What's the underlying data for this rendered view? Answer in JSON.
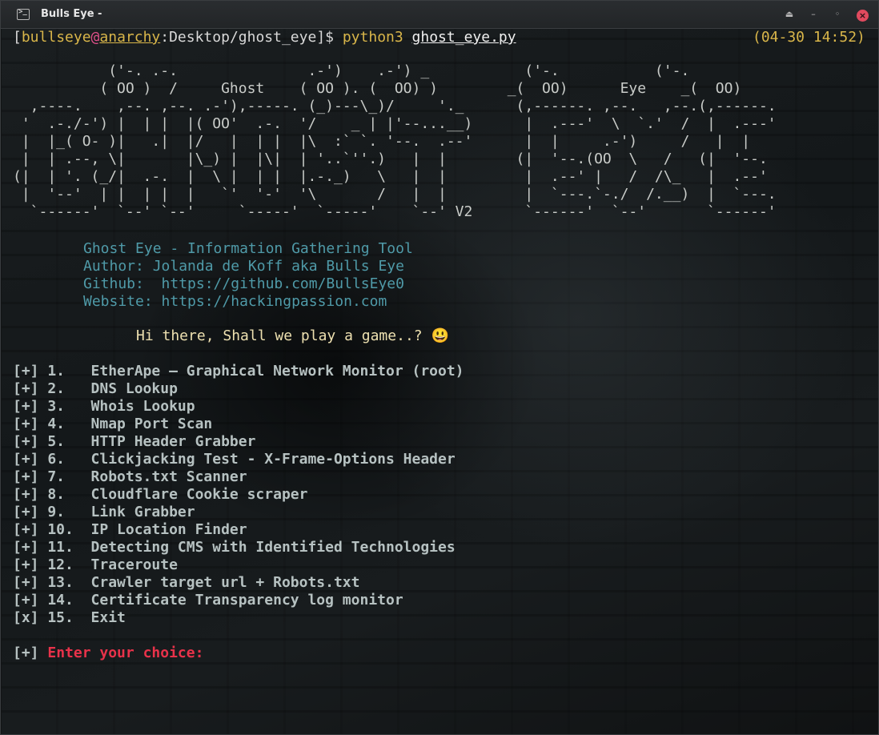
{
  "window": {
    "title": "Bulls Eye -",
    "buttons": {
      "eject": "⏏",
      "minimize": "–",
      "maximize": "◦",
      "close": "×"
    }
  },
  "prompt": {
    "open": "[",
    "user": "bullseye",
    "at": "@",
    "host": "anarchy",
    "path": ":Desktop/ghost_eye]",
    "dollar": "$ ",
    "command": "python3",
    "space": " ",
    "file": "ghost_eye.py",
    "datetime": "(04-30 14:52)"
  },
  "banner": {
    "ascii": "           ('-. .-.               .-')    .-') _           ('-.           ('-.\n          ( OO )  /     Ghost    ( OO ). (  OO) )        _(  OO)      Eye    _(  OO)\n  ,----.    ,--. ,--. .-'),-----. (_)---\\_)/     '._      (,------. ,--.   ,--.(,------.\n '  .-./-') |  | |  |( OO'  .-.  '/    _ | |'--...__)      |  .---'  \\  `.'  /  |  .---'\n |  |_( O- )|   .|  |/   |  | |  |\\  :` `. '--.  .--'      |  |     .-')     /   |  |\n |  | .--, \\|       |\\_) |  |\\|  | '..`''.)   |  |        (|  '--.(OO  \\   /   (|  '--.\n(|  | '. (_/|  .-.  |  \\ |  | |  |.-._)   \\   |  |         |  .--' |   /  /\\_   |  .--'\n |  '--'  | |  | |  |   `'  '-'  '\\       /   |  |         |  `---.`-./  /.__)  |  `---.\n  `------'  `--' `--'     `-----'  `-----'    `--' V2      `------'  `--'       `------'"
  },
  "info": {
    "line1": "Ghost Eye - Information Gathering Tool",
    "line2": "Author: Jolanda de Koff aka Bulls Eye",
    "line3": "Github:  https://github.com/BullsEye0",
    "line4": "Website: https://hackingpassion.com"
  },
  "greeting": "Hi there, Shall we play a game..? 😃",
  "menu": [
    "[+] 1.   EtherApe – Graphical Network Monitor (root)",
    "[+] 2.   DNS Lookup",
    "[+] 3.   Whois Lookup",
    "[+] 4.   Nmap Port Scan",
    "[+] 5.   HTTP Header Grabber",
    "[+] 6.   Clickjacking Test - X-Frame-Options Header",
    "[+] 7.   Robots.txt Scanner",
    "[+] 8.   Cloudflare Cookie scraper",
    "[+] 9.   Link Grabber",
    "[+] 10.  IP Location Finder",
    "[+] 11.  Detecting CMS with Identified Technologies",
    "[+] 12.  Traceroute",
    "[+] 13.  Crawler target url + Robots.txt",
    "[+] 14.  Certificate Transparency log monitor",
    "[x] 15.  Exit"
  ],
  "input_prompt": {
    "prefix": "[+] ",
    "label": "Enter your choice:"
  },
  "colors": {
    "prompt_user": "#d9b64a",
    "prompt_at": "#e0508a",
    "info": "#4f9aa8",
    "menu": "#b6c1c1",
    "choice_label": "#e8324a"
  }
}
